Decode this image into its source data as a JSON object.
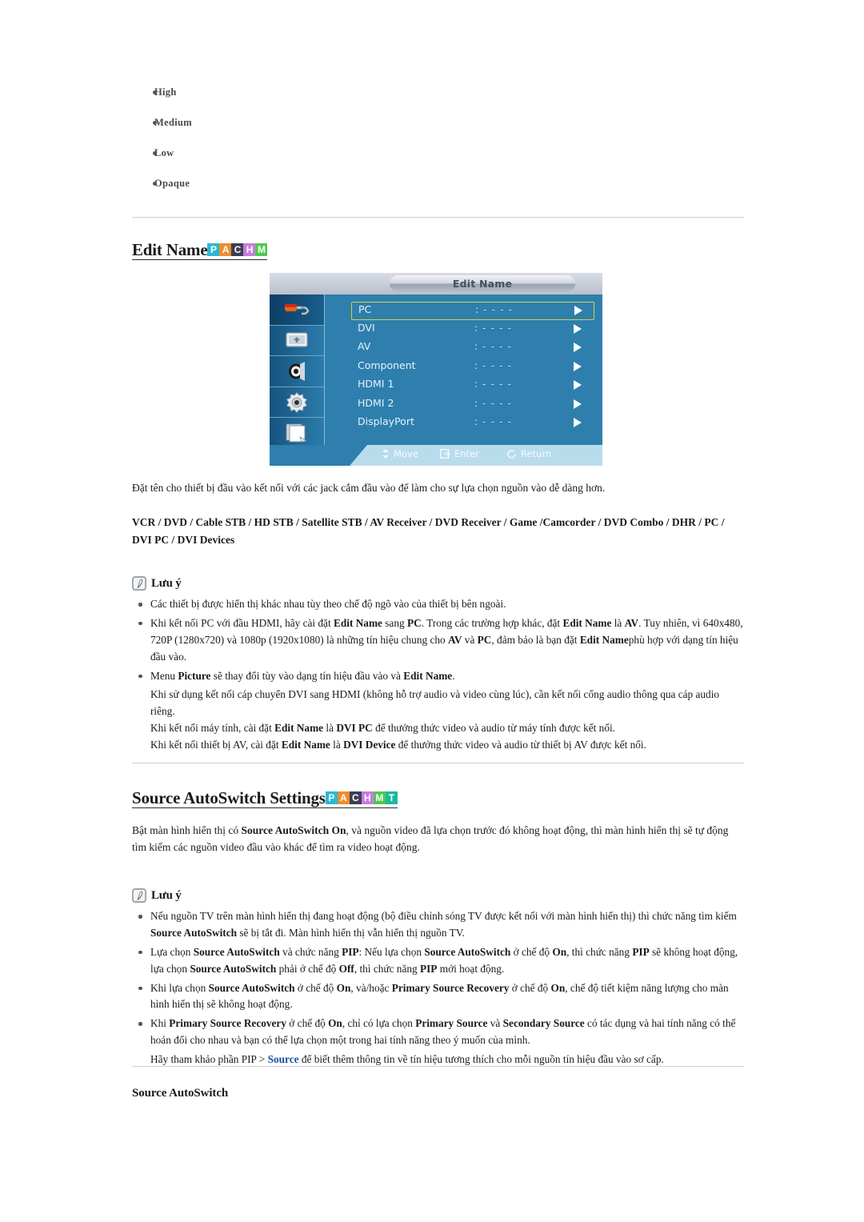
{
  "options_list": [
    {
      "label": "High"
    },
    {
      "label": "Medium"
    },
    {
      "label": "Low"
    },
    {
      "label": "Opaque"
    }
  ],
  "section_edit_name": {
    "title": "Edit Name",
    "badges": [
      {
        "letter": "P",
        "color": "#2bb8d4"
      },
      {
        "letter": "A",
        "color": "#f08c2e"
      },
      {
        "letter": "C",
        "color": "#3a3f54"
      },
      {
        "letter": "H",
        "color": "#c87be0"
      },
      {
        "letter": "M",
        "color": "#4fc84f"
      }
    ],
    "osd": {
      "title": "Edit Name",
      "sidebar_icons": [
        "picture-roller-icon",
        "screen-adjust-icon",
        "sound-speaker-icon",
        "setup-gear-icon",
        "multi-control-icon"
      ],
      "rows": [
        {
          "label": "PC",
          "colon": ":",
          "value": "- - - -",
          "selected": true
        },
        {
          "label": "DVI",
          "colon": ":",
          "value": "- - - -",
          "selected": false
        },
        {
          "label": "AV",
          "colon": ":",
          "value": "- - - -",
          "selected": false
        },
        {
          "label": "Component",
          "colon": ":",
          "value": "- - - -",
          "selected": false
        },
        {
          "label": "HDMI 1",
          "colon": ":",
          "value": "- - - -",
          "selected": false
        },
        {
          "label": "HDMI 2",
          "colon": ":",
          "value": "- - - -",
          "selected": false
        },
        {
          "label": "DisplayPort",
          "colon": ":",
          "value": "- - - -",
          "selected": false
        }
      ],
      "footer": [
        {
          "icon": "move-diamond-icon",
          "label": "Move"
        },
        {
          "icon": "enter-arrow-icon",
          "label": "Enter"
        },
        {
          "icon": "return-circle-icon",
          "label": "Return"
        }
      ]
    },
    "description": "Đặt tên cho thiết bị đầu vào kết nối với các jack cắm đầu vào để làm cho sự lựa chọn nguồn vào dễ dàng hơn.",
    "device_list": "VCR / DVD / Cable STB / HD STB / Satellite STB / AV Receiver / DVD Receiver / Game /Camcorder / DVD Combo / DHR / PC / DVI PC / DVI Devices",
    "note": {
      "label": "Lưu ý",
      "items": [
        {
          "lines": [
            "Các thiết bị được hiển thị khác nhau tùy theo chế độ ngõ vào của thiết bị bên ngoài."
          ]
        },
        {
          "lines": [
            "Khi kết nối PC với đầu HDMI, hãy cài đặt <b>Edit Name</b> sang <b>PC</b>. Trong các trường hợp khác, đặt <b>Edit Name</b> là <b>AV</b>. Tuy nhiên, vì 640x480, 720P (1280x720) và 1080p (1920x1080) là những tín hiệu chung cho <b>AV</b> và <b>PC</b>, đảm bảo là bạn đặt <b>Edit Name</b>phù hợp với dạng tín hiệu đầu vào."
          ]
        },
        {
          "lines": [
            "Menu <b>Picture</b> sẽ thay đổi tùy vào dạng tín hiệu đầu vào và <b>Edit Name</b>.",
            "Khi sử dụng kết nối cáp chuyển DVI sang HDMI (không hỗ trợ audio và video cùng lúc), cần kết nối cổng audio thông qua cáp audio riêng.",
            "Khi kết nối máy tính, cài đặt <b>Edit Name</b> là <b>DVI PC</b> để thưởng thức video và audio từ máy tính được kết nối.",
            "Khi kết nối thiết bị AV, cài đặt <b>Edit Name</b> là <b>DVI Device</b> để thưởng thức video và audio từ thiết bị AV được kết nối."
          ]
        }
      ]
    }
  },
  "section_source_autoswitch": {
    "title": "Source AutoSwitch Settings",
    "badges": [
      {
        "letter": "P",
        "color": "#2bb8d4"
      },
      {
        "letter": "A",
        "color": "#f08c2e"
      },
      {
        "letter": "C",
        "color": "#3a3f54"
      },
      {
        "letter": "H",
        "color": "#c87be0"
      },
      {
        "letter": "M",
        "color": "#4fc84f"
      },
      {
        "letter": "T",
        "color": "#1fb89b"
      }
    ],
    "description": "Bật màn hình hiển thị có <b>Source AutoSwitch On</b>, và nguồn video đã lựa chọn trước đó không hoạt động, thì màn hình hiển thị sẽ tự động tìm kiếm các nguồn video đầu vào khác để tìm ra video hoạt động.",
    "note": {
      "label": "Lưu ý",
      "items": [
        {
          "lines": [
            "Nếu nguồn TV trên màn hình hiển thị đang hoạt động (bộ điều chỉnh sóng TV được kết nối với màn hình hiển thị) thì chức năng tìm kiếm <b>Source AutoSwitch</b> sẽ bị tắt đi. Màn hình hiển thị vẫn hiển thị nguồn TV."
          ]
        },
        {
          "lines": [
            "Lựa chọn <b>Source AutoSwitch</b> và chức năng <b>PIP</b>: Nếu lựa chọn <b>Source AutoSwitch</b> ở chế độ <b>On</b>, thì chức năng <b>PIP</b> sẽ không hoạt động, lựa chọn <b>Source AutoSwitch</b> phải ở chế độ <b>Off</b>, thì chức năng <b>PIP</b> mới hoạt động."
          ]
        },
        {
          "lines": [
            "Khi lựa chọn <b>Source AutoSwitch</b> ở chế độ <b>On</b>, và/hoặc <b>Primary Source Recovery</b> ở chế độ <b>On</b>, chế độ tiết kiệm năng lượng cho màn hình hiển thị sẽ không hoạt động."
          ]
        },
        {
          "lines": [
            "Khi <b>Primary Source Recovery</b> ở chế độ <b>On</b>, chỉ có lựa chọn <b>Primary Source</b> và <b>Secondary Source</b> có tác dụng và hai tính năng có thể hoán đổi cho nhau và bạn có thể lựa chọn một trong hai tính năng theo ý muốn của mình.",
            "Hãy tham khảo phần PIP &gt; <span class=\"lnk\">Source</span> để biết thêm thông tin về tín hiệu tương thích cho mỗi nguồn tín hiệu đầu vào sơ cấp."
          ]
        }
      ]
    }
  },
  "section_source_autoswitch_sub": {
    "title": "Source AutoSwitch"
  }
}
